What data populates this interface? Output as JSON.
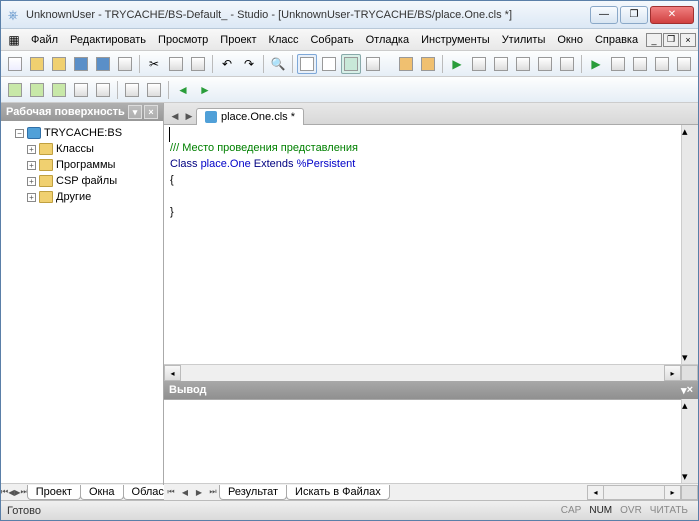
{
  "window": {
    "title": "UnknownUser - TRYCACHE/BS-Default_ - Studio - [UnknownUser-TRYCACHE/BS/place.One.cls *]"
  },
  "menu": {
    "items": [
      "Файл",
      "Редактировать",
      "Просмотр",
      "Проект",
      "Класс",
      "Собрать",
      "Отладка",
      "Инструменты",
      "Утилиты",
      "Окно",
      "Справка"
    ]
  },
  "sidebar": {
    "header": "Рабочая поверхность",
    "root": "TRYCACHE:BS",
    "nodes": [
      "Классы",
      "Программы",
      "CSP файлы",
      "Другие"
    ]
  },
  "editor": {
    "tab_label": "place.One.cls *",
    "code": {
      "l1_a": "/// ",
      "l1_b": "Место проведения представления",
      "l2_a": "Class ",
      "l2_b": "place.One ",
      "l2_c": "Extends ",
      "l2_d": "%Persistent",
      "l3": "{",
      "l4": "",
      "l5": "}"
    }
  },
  "output": {
    "header": "Вывод"
  },
  "left_tabs": [
    "Проект",
    "Окна",
    "Область"
  ],
  "right_tabs": [
    "Результат",
    "Искать в Файлах"
  ],
  "status": {
    "ready": "Готово",
    "caps": "CAP",
    "num": "NUM",
    "ovr": "OVR",
    "read": "ЧИТАТЬ"
  }
}
